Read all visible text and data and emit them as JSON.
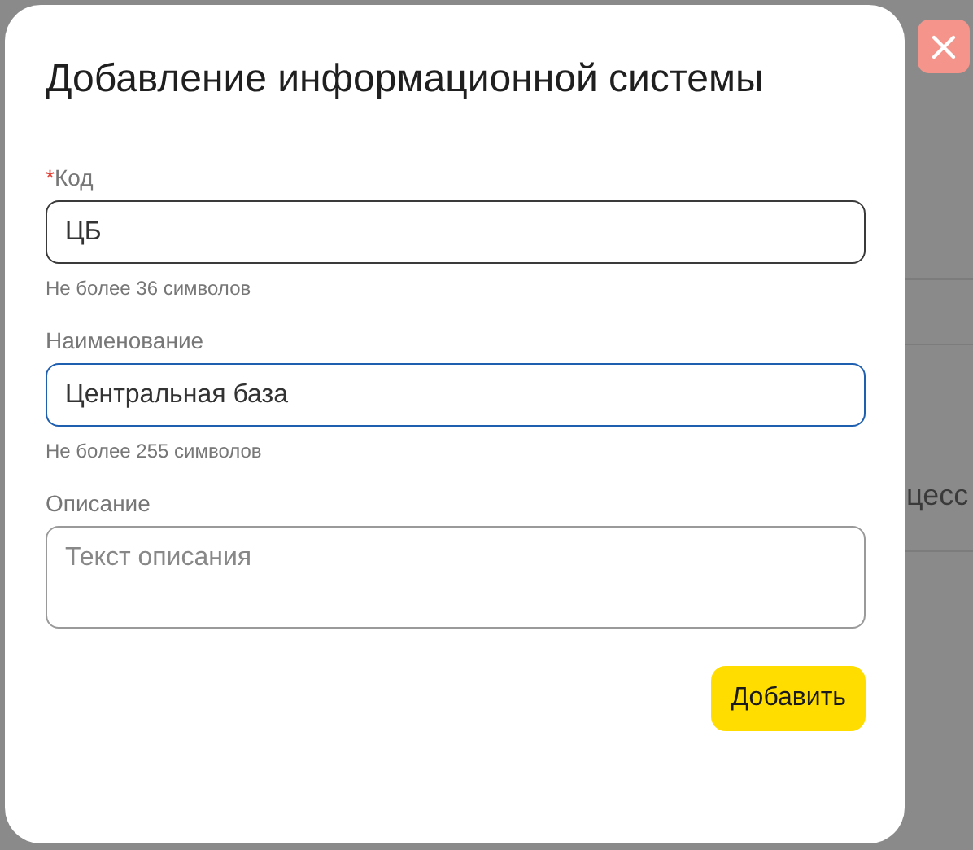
{
  "dialog": {
    "title": "Добавление информационной системы",
    "fields": [
      {
        "kind": "input",
        "label": "Код",
        "required_mark": "*",
        "value": "ЦБ",
        "hint": "Не более 36 символов",
        "focused": false
      },
      {
        "kind": "input",
        "label": "Наименование",
        "value": "Центральная база",
        "hint": "Не более 255 символов",
        "focused": true
      },
      {
        "kind": "textarea",
        "label": "Описание",
        "placeholder": "Текст описания",
        "focused": false
      }
    ],
    "submit_button": "Добавить"
  },
  "background": {
    "text_fragment": "цесс"
  }
}
